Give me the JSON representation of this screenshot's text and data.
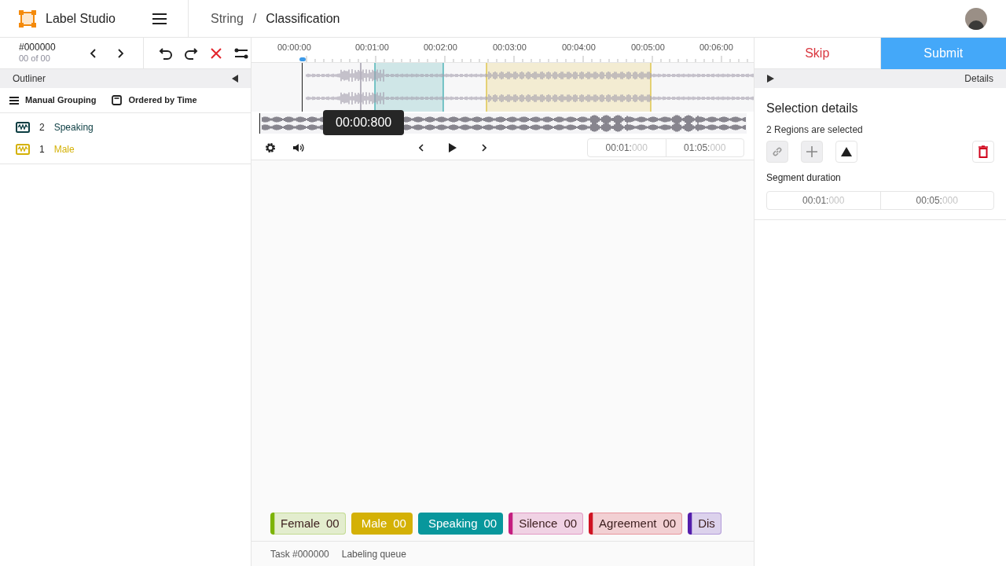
{
  "header": {
    "app_name": "Label Studio",
    "breadcrumb": [
      "String",
      "Classification"
    ],
    "separator": "/"
  },
  "task_nav": {
    "id": "#000000",
    "position": "00 of 00"
  },
  "actions": {
    "skip": "Skip",
    "submit": "Submit"
  },
  "outliner": {
    "title": "Outliner",
    "grouping": "Manual Grouping",
    "ordering": "Ordered by Time",
    "regions": [
      {
        "count": "2",
        "label": "Speaking",
        "color": "#0b3d42"
      },
      {
        "count": "1",
        "label": "Male",
        "color": "#d4b106"
      }
    ]
  },
  "timeline": {
    "ticks": [
      "00:00:00",
      "00:01:00",
      "00:02:00",
      "00:03:00",
      "00:04:00",
      "00:05:00",
      "00:06:00"
    ],
    "tooltip": "00:00:800",
    "start": {
      "main": "00:01:",
      "ms": "000"
    },
    "end": {
      "main": "01:05:",
      "ms": "000"
    }
  },
  "details": {
    "tab": "Details",
    "title": "Selection details",
    "subtitle": "2 Regions are selected",
    "duration_label": "Segment duration",
    "start": {
      "main": "00:01:",
      "ms": "000"
    },
    "end": {
      "main": "00:05:",
      "ms": "000"
    }
  },
  "labels": [
    {
      "text": "Female",
      "count": "00",
      "color": "#7cb305",
      "selected": false
    },
    {
      "text": "Male",
      "count": "00",
      "color": "#d4b106",
      "selected": true
    },
    {
      "text": "Speaking",
      "count": "00",
      "color": "#08979c",
      "selected": true
    },
    {
      "text": "Silence",
      "count": "00",
      "color": "#c41d7f",
      "selected": false
    },
    {
      "text": "Agreement",
      "count": "00",
      "color": "#cf1322",
      "selected": false
    },
    {
      "text": "Dis",
      "color": "#531dab",
      "selected": false
    }
  ],
  "status_bar": [
    "Task #000000",
    "Labeling queue"
  ]
}
